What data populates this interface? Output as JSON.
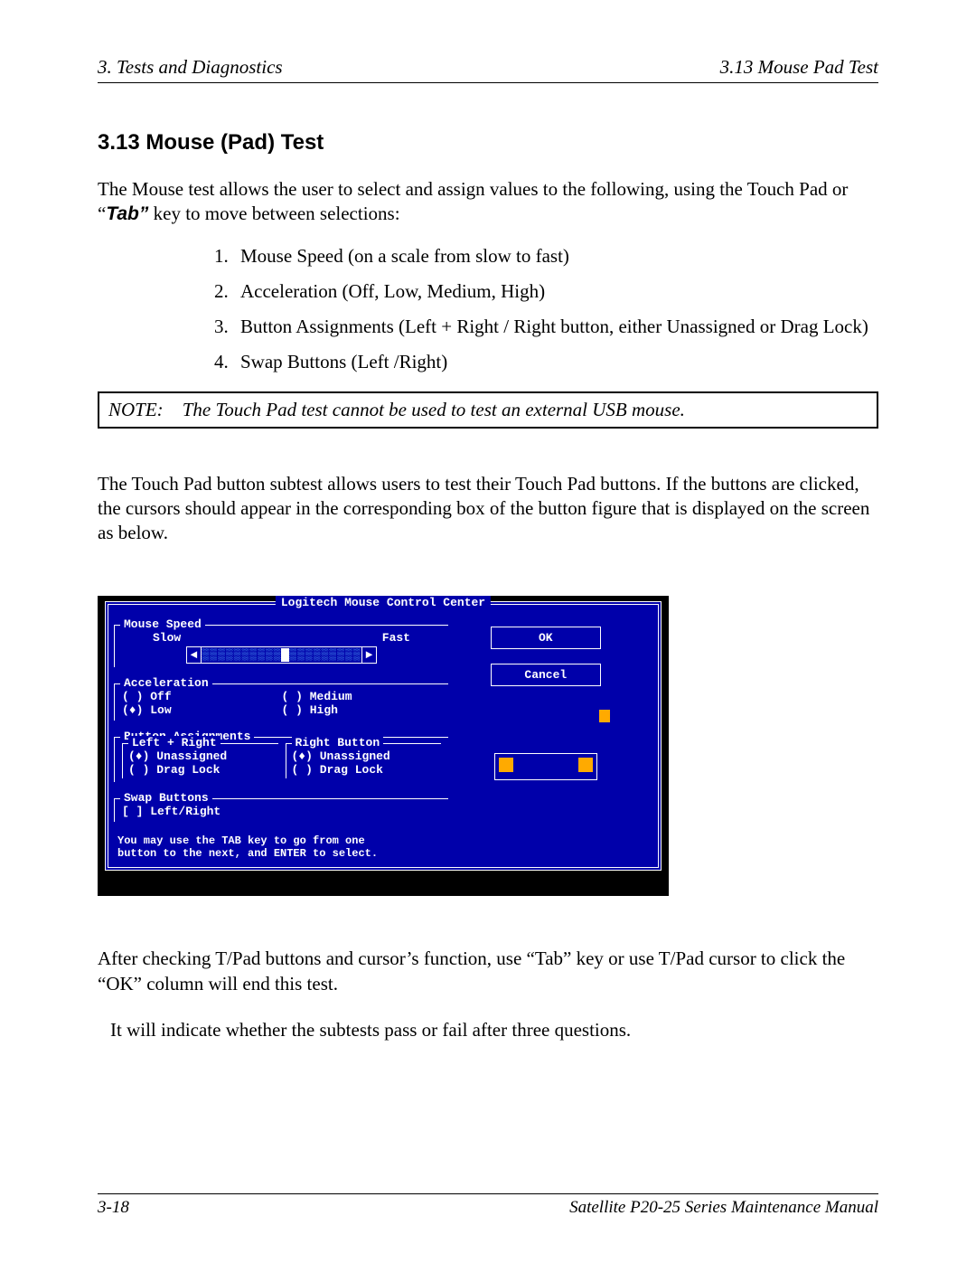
{
  "header": {
    "left": "3.  Tests and Diagnostics",
    "right": "3.13  Mouse Pad Test"
  },
  "section_title": "3.13  Mouse (Pad) Test",
  "intro": {
    "part1": "The Mouse test allows the user to select and assign values to the following, using the Touch Pad or “",
    "tab": "Tab”",
    "part2": " key to move between selections:"
  },
  "list": [
    "Mouse Speed (on a scale from slow to fast)",
    "Acceleration (Off, Low, Medium, High)",
    "Button Assignments (Left + Right / Right button, either Unassigned or Drag Lock)",
    "Swap Buttons (Left /Right)"
  ],
  "note": {
    "label": "NOTE:",
    "text": "The Touch Pad test cannot be used to test an external USB mouse."
  },
  "para2": "The Touch Pad button subtest allows users to test their Touch Pad buttons. If the buttons are clicked, the cursors should appear in the corresponding box of the button figure that is displayed on the screen as below.",
  "dos": {
    "title": "Logitech Mouse Control Center",
    "speed": {
      "legend": "Mouse Speed",
      "slow": "Slow",
      "fast": "Fast"
    },
    "accel": {
      "legend": "Acceleration",
      "options": [
        {
          "mark": "( )",
          "label": "Off"
        },
        {
          "mark": "( )",
          "label": "Medium"
        },
        {
          "mark": "(♦)",
          "label": "Low"
        },
        {
          "mark": "( )",
          "label": "High"
        }
      ]
    },
    "ba": {
      "legend": "Button Assignments",
      "left": {
        "legend": "Left + Right",
        "opts": [
          {
            "mark": "(♦)",
            "label": "Unassigned"
          },
          {
            "mark": "( )",
            "label": "Drag Lock"
          }
        ]
      },
      "right": {
        "legend": "Right Button",
        "opts": [
          {
            "mark": "(♦)",
            "label": "Unassigned"
          },
          {
            "mark": "( )",
            "label": "Drag Lock"
          }
        ]
      }
    },
    "swap": {
      "legend": "Swap Buttons",
      "opt": "[ ] Left/Right"
    },
    "hint1": "You may use the TAB key to go from one",
    "hint2": "button to the next, and ENTER to select.",
    "ok": "OK",
    "cancel": "Cancel"
  },
  "para3": "After checking T/Pad buttons and cursor’s function, use “Tab” key or use T/Pad cursor to click the “OK” column will end this test.",
  "para4": "It will indicate whether the subtests pass or fail after three questions.",
  "footer": {
    "left": "3-18",
    "right": "Satellite P20-25 Series Maintenance Manual"
  }
}
